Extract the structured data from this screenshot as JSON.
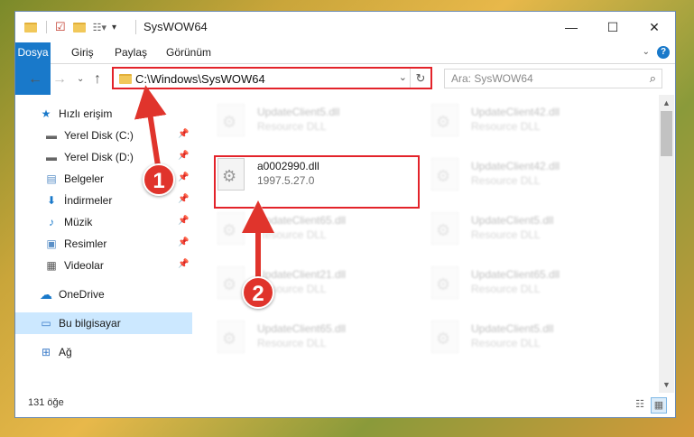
{
  "window": {
    "title": "SysWOW64",
    "minimize": "—",
    "maximize": "☐",
    "close": "✕"
  },
  "ribbon": {
    "tabs": [
      "Dosya",
      "Giriş",
      "Paylaş",
      "Görünüm"
    ],
    "help": "?"
  },
  "address": {
    "path": "C:\\Windows\\SysWOW64",
    "search_placeholder": "Ara: SysWOW64"
  },
  "nav": {
    "quick_access": "Hızlı erişim",
    "items": [
      {
        "label": "Yerel Disk (C:)",
        "icon": "drive-icon"
      },
      {
        "label": "Yerel Disk (D:)",
        "icon": "drive-icon"
      },
      {
        "label": "Belgeler",
        "icon": "documents-icon"
      },
      {
        "label": "İndirmeler",
        "icon": "downloads-icon"
      },
      {
        "label": "Müzik",
        "icon": "music-icon"
      },
      {
        "label": "Resimler",
        "icon": "pictures-icon"
      },
      {
        "label": "Videolar",
        "icon": "videos-icon"
      }
    ],
    "onedrive": "OneDrive",
    "this_pc": "Bu bilgisayar",
    "network": "Ağ"
  },
  "files": [
    {
      "name": "UpdateClient5.dll",
      "desc": "Resource DLL"
    },
    {
      "name": "UpdateClient42.dll",
      "desc": "Resource DLL"
    },
    {
      "name": "a0002990.dll",
      "desc": "1997.5.27.0"
    },
    {
      "name": "UpdateClient42.dll",
      "desc": "Resource DLL"
    },
    {
      "name": "UpdateClient65.dll",
      "desc": "Resource DLL"
    },
    {
      "name": "UpdateClient5.dll",
      "desc": "Resource DLL"
    },
    {
      "name": "UpdateClient21.dll",
      "desc": "Resource DLL"
    },
    {
      "name": "UpdateClient65.dll",
      "desc": "Resource DLL"
    },
    {
      "name": "UpdateClient65.dll",
      "desc": "Resource DLL"
    },
    {
      "name": "UpdateClient5.dll",
      "desc": "Resource DLL"
    }
  ],
  "status": {
    "count": "131 öğe"
  },
  "callouts": [
    "1",
    "2"
  ],
  "colors": {
    "accent": "#1979ca",
    "highlight": "#e3232a",
    "badge": "#e0342c"
  }
}
